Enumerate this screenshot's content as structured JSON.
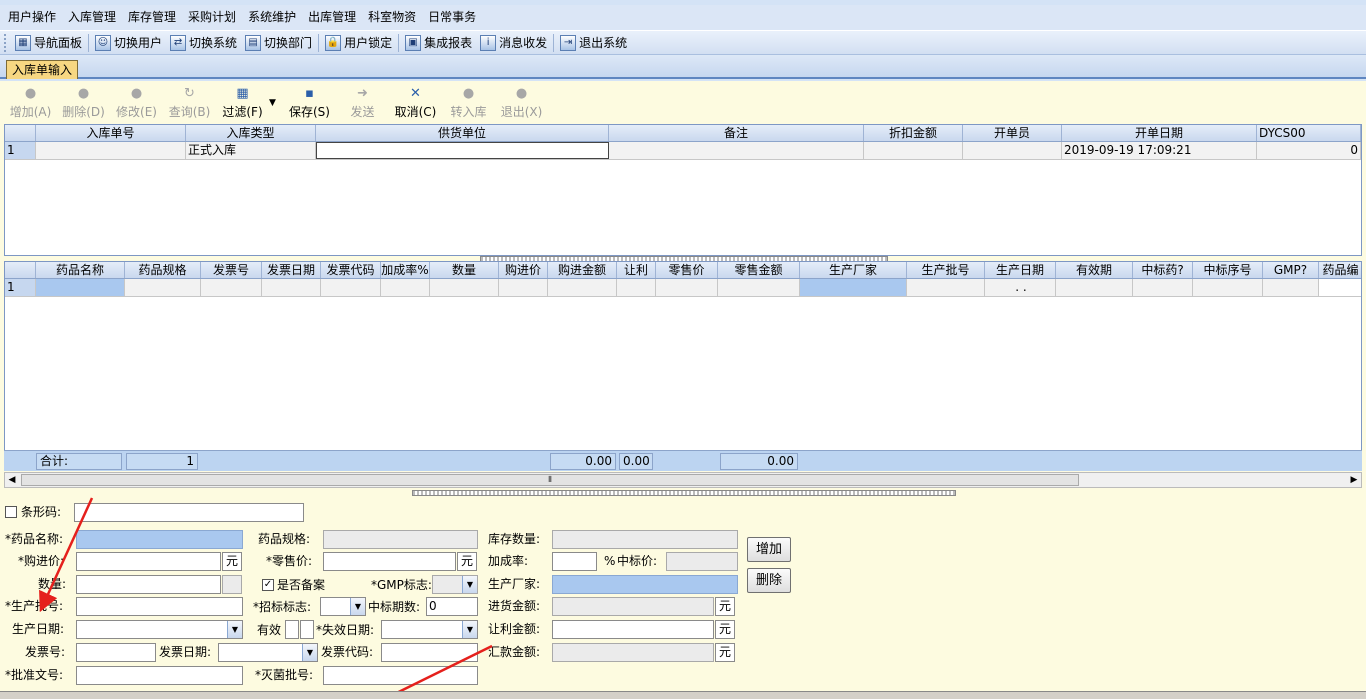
{
  "menu": [
    "用户操作",
    "入库管理",
    "库存管理",
    "采购计划",
    "系统维护",
    "出库管理",
    "科室物资",
    "日常事务"
  ],
  "toolbar": [
    {
      "label": "导航面板",
      "icon": "navigation-icon"
    },
    {
      "label": "切换用户",
      "icon": "switch-user-icon"
    },
    {
      "label": "切换系统",
      "icon": "switch-system-icon"
    },
    {
      "label": "切换部门",
      "icon": "switch-department-icon"
    },
    {
      "label": "用户锁定",
      "icon": "user-lock-icon"
    },
    {
      "label": "集成报表",
      "icon": "report-icon"
    },
    {
      "label": "消息收发",
      "icon": "message-icon"
    },
    {
      "label": "退出系统",
      "icon": "exit-icon"
    }
  ],
  "tab": "入库单输入",
  "actions": [
    {
      "label": "增加(A)",
      "enabled": false
    },
    {
      "label": "删除(D)",
      "enabled": false
    },
    {
      "label": "修改(E)",
      "enabled": false
    },
    {
      "label": "查询(B)",
      "enabled": false
    },
    {
      "label": "过滤(F)",
      "enabled": true
    },
    {
      "label": "保存(S)",
      "enabled": true
    },
    {
      "label": "发送",
      "enabled": false
    },
    {
      "label": "取消(C)",
      "enabled": true
    },
    {
      "label": "转入库",
      "enabled": false
    },
    {
      "label": "退出(X)",
      "enabled": false
    }
  ],
  "grid1": {
    "headers": [
      "",
      "入库单号",
      "入库类型",
      "供货单位",
      "备注",
      "折扣金额",
      "开单员",
      "开单日期",
      "DYCS00"
    ],
    "row": [
      "1",
      "",
      "正式入库",
      "",
      "",
      "",
      "",
      "2019-09-19 17:09:21",
      "0"
    ]
  },
  "grid2": {
    "headers": [
      "",
      "药品名称",
      "药品规格",
      "发票号",
      "发票日期",
      "发票代码",
      "加成率%",
      "数量",
      "购进价",
      "购进金额",
      "让利",
      "零售价",
      "零售金额",
      "生产厂家",
      "生产批号",
      "生产日期",
      "有效期",
      "中标药?",
      "中标序号",
      "GMP?",
      "药品编"
    ],
    "row": [
      "1",
      "",
      "",
      "",
      "",
      "",
      "",
      "",
      "",
      "",
      "",
      "",
      "",
      "",
      "",
      ". .",
      "",
      "",
      "",
      "",
      ""
    ]
  },
  "totals": {
    "label": "合计:",
    "count": "1",
    "purchase_amount": "0.00",
    "discount": "0.00",
    "retail_amount": "0.00"
  },
  "form": {
    "barcode_label": "条形码:",
    "drug_name_label": "*药品名称:",
    "drug_spec_label": "药品规格:",
    "stock_qty_label": "库存数量:",
    "purchase_price_label": "*购进价:",
    "retail_price_label": "*零售价:",
    "markup_label": "加成率:",
    "markup_unit": "%",
    "bid_price_label": "中标价:",
    "qty_label": "数量:",
    "filed_label": "是否备案",
    "gmp_label": "*GMP标志:",
    "manufacturer_label": "生产厂家:",
    "batch_label": "*生产批号:",
    "bid_flag_label": "*招标标志:",
    "bid_period_label": "中标期数:",
    "bid_period_value": "0",
    "incoming_amount_label": "进货金额:",
    "prod_date_label": "生产日期:",
    "valid_label": "有效",
    "expiry_label": "*失效日期:",
    "discount_amount_label": "让利金额:",
    "invoice_no_label": "发票号:",
    "invoice_date_label": "发票日期:",
    "invoice_code_label": "发票代码:",
    "remit_amount_label": "汇款金额:",
    "approval_label": "*批准文号:",
    "sterile_label": "*灭菌批号:",
    "yuan": "元",
    "add_button": "增加",
    "delete_button": "删除"
  }
}
